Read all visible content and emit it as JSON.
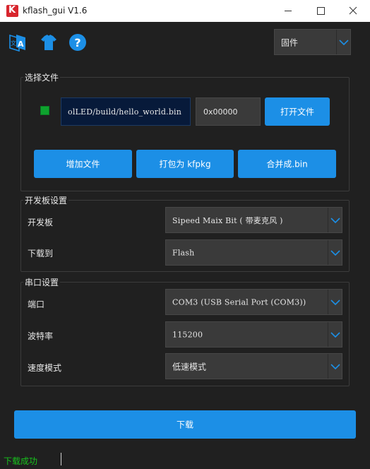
{
  "window": {
    "title": "kflash_gui V1.6",
    "app_icon_letter": "K"
  },
  "toolbar": {
    "icons": [
      "language-icon",
      "shirt-icon",
      "help-icon"
    ],
    "mode_select": "固件"
  },
  "file_section": {
    "title": "选择文件",
    "file_path": "olLED/build/hello_world.bin",
    "address": "0x00000",
    "open_button": "打开文件",
    "add_button": "增加文件",
    "pack_button": "打包为 kfpkg",
    "merge_button": "合并成.bin"
  },
  "board_section": {
    "title": "开发板设置",
    "board_label": "开发板",
    "board_value": "Sipeed Maix Bit ( 带麦克风 )",
    "target_label": "下载到",
    "target_value": "Flash"
  },
  "serial_section": {
    "title": "串口设置",
    "port_label": "端口",
    "port_value": "COM3 (USB Serial Port (COM3))",
    "baud_label": "波特率",
    "baud_value": "115200",
    "speed_label": "速度模式",
    "speed_value": "低速模式"
  },
  "download_button": "下载",
  "status": {
    "text": "下载成功"
  },
  "colors": {
    "accent": "#1c8fe6",
    "background": "#202020",
    "success": "#17c21d"
  }
}
